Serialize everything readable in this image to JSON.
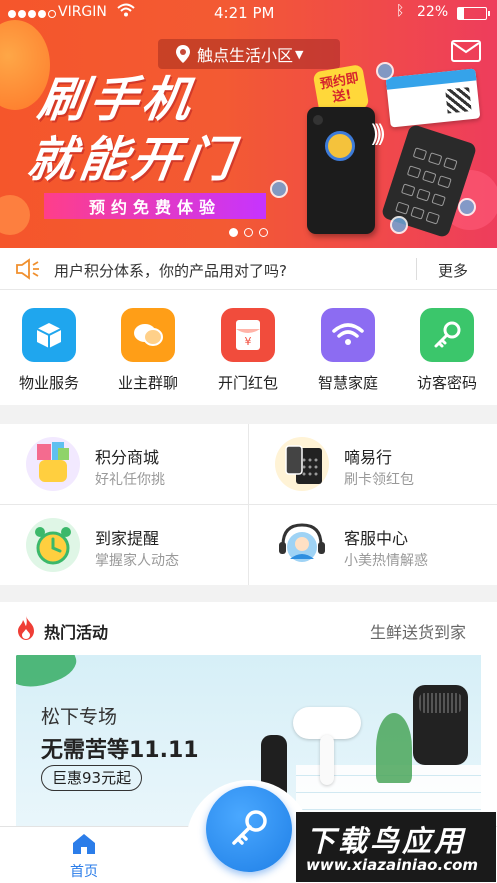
{
  "status_bar": {
    "carrier": "VIRGIN",
    "time": "4:21 PM",
    "battery": "22%",
    "battery_level": 0.22
  },
  "location": {
    "community": "触点生活小区"
  },
  "banner": {
    "headline_line1": "刷手机",
    "headline_line2": "就能开门",
    "cta": "预约免费体验",
    "stamp": "预约即送!",
    "page_count": 3,
    "active_page": 0
  },
  "notice": {
    "text": "用户积分体系，你的产品用对了吗?",
    "more": "更多"
  },
  "quick_actions": [
    {
      "label": "物业服务",
      "icon": "box-icon",
      "color": "#1fa6ee"
    },
    {
      "label": "业主群聊",
      "icon": "chat-icon",
      "color": "#ff9e17"
    },
    {
      "label": "开门红包",
      "icon": "red-envelope-icon",
      "color": "#f14c3c"
    },
    {
      "label": "智慧家庭",
      "icon": "wifi-icon",
      "color": "#8c6cf2"
    },
    {
      "label": "访客密码",
      "icon": "key-icon",
      "color": "#3bc66b"
    }
  ],
  "features": [
    {
      "title": "积分商城",
      "subtitle": "好礼任你挑",
      "icon": "gift-basket-icon"
    },
    {
      "title": "嘀易行",
      "subtitle": "刷卡领红包",
      "icon": "card-reader-icon"
    },
    {
      "title": "到家提醒",
      "subtitle": "掌握家人动态",
      "icon": "alarm-clock-icon"
    },
    {
      "title": "客服中心",
      "subtitle": "小美热情解惑",
      "icon": "headset-agent-icon"
    }
  ],
  "hot": {
    "title": "热门活动",
    "link": "生鲜送货到家",
    "promo": {
      "line1": "松下专场",
      "line2": "无需苦等11.11",
      "tag": "巨惠93元起"
    }
  },
  "tabbar": {
    "home": "首页"
  },
  "watermark": {
    "line1": "下载鸟应用",
    "line2": "www.xiazainiao.com"
  }
}
